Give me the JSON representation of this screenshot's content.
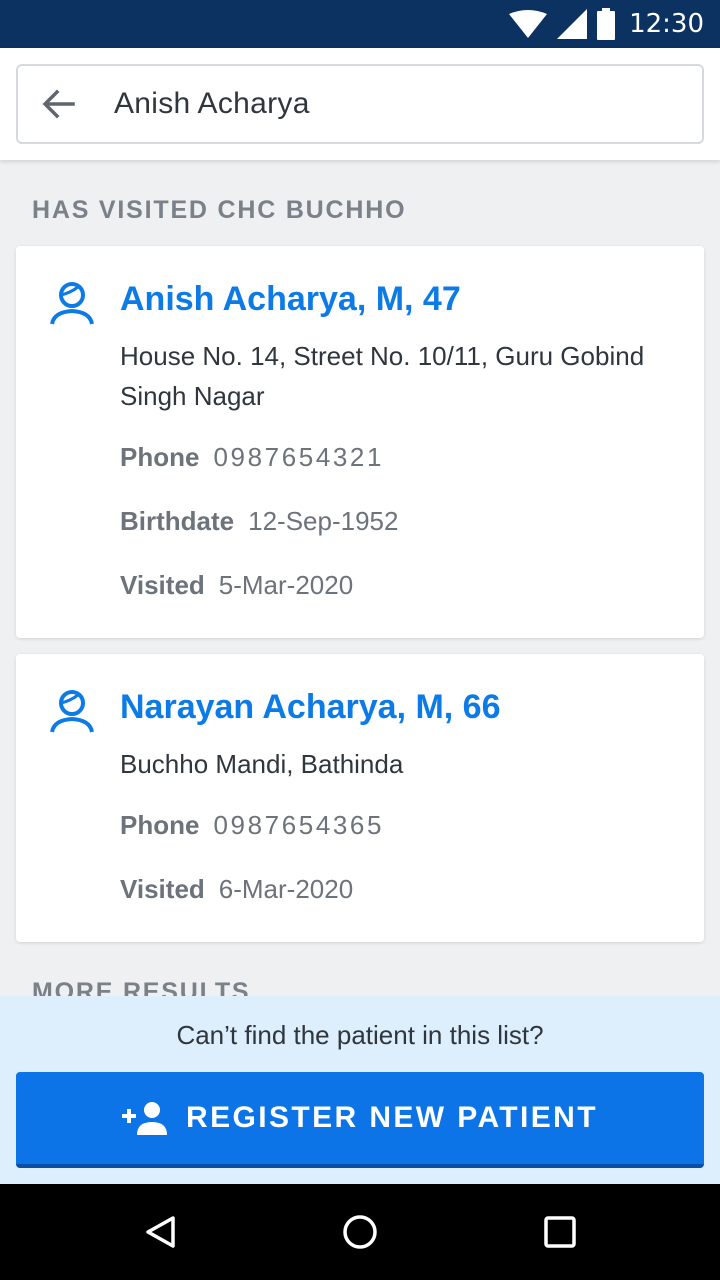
{
  "status_bar": {
    "time": "12:30",
    "icons": [
      "wifi-icon",
      "signal-icon",
      "battery-icon"
    ]
  },
  "search": {
    "value": "Anish Acharya",
    "back_icon": "arrow-back-icon"
  },
  "section": {
    "visited_header": "HAS VISITED CHC BUCHHO",
    "more_header": "MORE RESULTS"
  },
  "patients": [
    {
      "name": "Anish Acharya, M, 47",
      "address": "House No. 14, Street No. 10/11, Guru Gobind Singh Nagar",
      "phone_label": "Phone",
      "phone": "0987654321",
      "birthdate_label": "Birthdate",
      "birthdate": "12-Sep-1952",
      "visited_label": "Visited",
      "visited": "5-Mar-2020"
    },
    {
      "name": "Narayan Acharya, M, 66",
      "address": "Buchho Mandi, Bathinda",
      "phone_label": "Phone",
      "phone": "0987654365",
      "visited_label": "Visited",
      "visited": "6-Mar-2020"
    }
  ],
  "footer": {
    "prompt": "Can’t find the patient in this list?",
    "register_label": "REGISTER NEW PATIENT",
    "register_icon": "add-person-icon"
  },
  "colors": {
    "status_bar": "#0b3260",
    "accent": "#0c7be5",
    "register_button": "#0c74e6",
    "footer_bg": "#ddeefc"
  }
}
